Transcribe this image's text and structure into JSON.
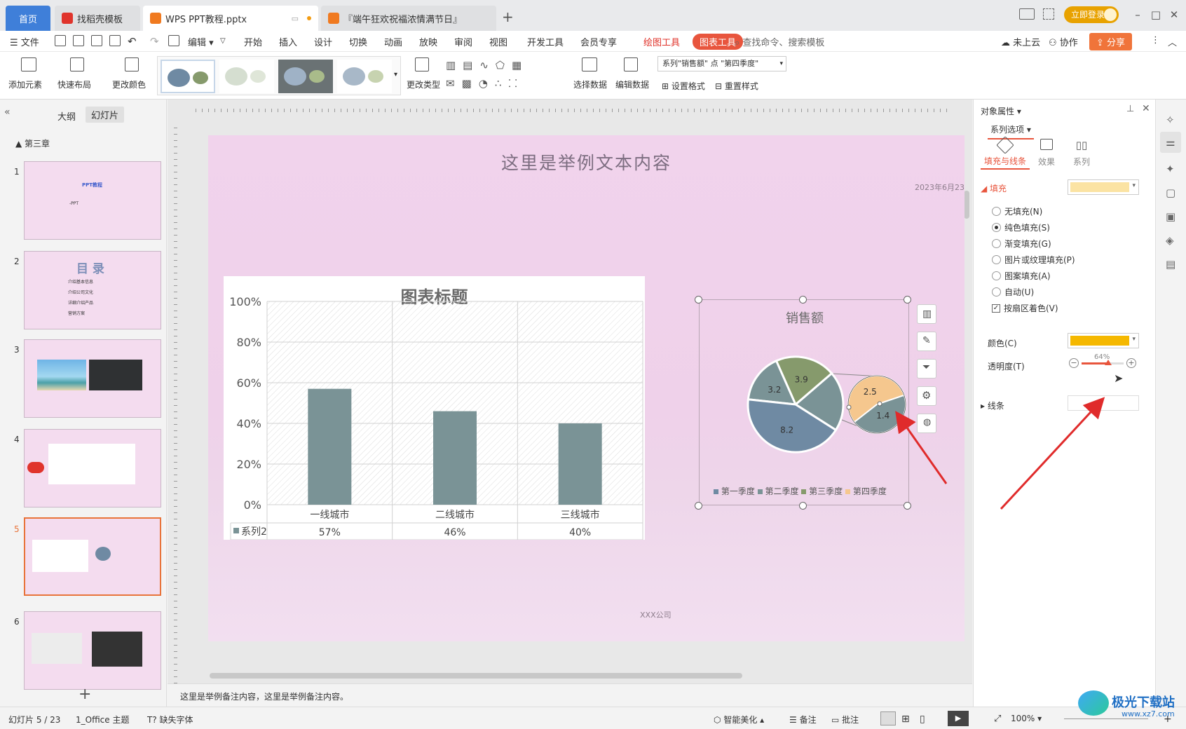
{
  "tabs": {
    "home": "首页",
    "template": "找稻壳模板",
    "doc": "WPS PPT教程.pptx",
    "doc2": "『端午狂欢祝福浓情满节日』",
    "login": "立即登录"
  },
  "menu": {
    "file": "文件",
    "edit": "编辑",
    "items": [
      "开始",
      "插入",
      "设计",
      "切换",
      "动画",
      "放映",
      "审阅",
      "视图",
      "开发工具",
      "会员专享"
    ],
    "draw_tools": "绘图工具",
    "chart_tools": "图表工具",
    "search": "查找命令、搜索模板",
    "cloud": "未上云",
    "collab": "协作",
    "share": "分享"
  },
  "ribbon": {
    "add_element": "添加元素",
    "quick_layout": "快速布局",
    "change_color": "更改颜色",
    "change_type": "更改类型",
    "select_data": "选择数据",
    "edit_data": "编辑数据",
    "selector": "系列\"销售额\" 点 \"第四季度\"",
    "set_format": "设置格式",
    "reset_style": "重置样式"
  },
  "left": {
    "outline": "大纲",
    "slides": "幻灯片",
    "section": "第三章",
    "thumb1_title": "PPT教程",
    "thumb1_sub": "-PPT",
    "thumb2_title": "目 录",
    "thumb2_items": [
      "介绍基本信息",
      "介绍公司文化",
      "详细介绍产品",
      "营销方案"
    ],
    "slide_numbers": [
      "1",
      "2",
      "3",
      "4",
      "5",
      "6"
    ]
  },
  "slide": {
    "title": "这里是举例文本内容",
    "date": "2023年6月23",
    "company": "XXX公司"
  },
  "bar_chart": {
    "title": "图表标题",
    "legend_series": "系列2",
    "chart_data": {
      "type": "bar",
      "categories": [
        "一线城市",
        "二线城市",
        "三线城市"
      ],
      "series": [
        {
          "name": "系列2",
          "values": [
            0.57,
            0.46,
            0.4
          ]
        }
      ],
      "value_labels": [
        "57%",
        "46%",
        "40%"
      ],
      "yticks": [
        "100%",
        "80%",
        "60%",
        "40%",
        "20%",
        "0%"
      ],
      "ylim": [
        0,
        1
      ],
      "bar_color": "#7a9396"
    }
  },
  "pie_chart": {
    "title": "销售额",
    "chart_data": {
      "type": "pie",
      "categories": [
        "第一季度",
        "第二季度",
        "第三季度",
        "第四季度"
      ],
      "main_values": [
        "8.2",
        "3.2",
        "3.9"
      ],
      "sub_values": [
        "2.5",
        "1.4"
      ],
      "colors": [
        "#6f8aa3",
        "#7a9396",
        "#869a6c",
        "#f5c78e"
      ]
    }
  },
  "notes": "这里是举例备注内容，这里是举例备注内容。",
  "panel": {
    "header": "对象属性",
    "series_options": "系列选项",
    "tab_fill": "填充与线条",
    "tab_effect": "效果",
    "tab_series": "系列",
    "fill": "填充",
    "fill_color": "#fbe3a3",
    "radios": [
      "无填充(N)",
      "纯色填充(S)",
      "渐变填充(G)",
      "图片或纹理填充(P)",
      "图案填充(A)",
      "自动(U)"
    ],
    "vary": "按扇区着色(V)",
    "color_label": "颜色(C)",
    "color_value": "#f5b800",
    "transparency_label": "透明度(T)",
    "transparency_value": "64%",
    "transparency_fraction": 0.64,
    "line": "线条"
  },
  "status": {
    "slide_count": "幻灯片 5 / 23",
    "theme": "1_Office 主题",
    "missing_font": "缺失字体",
    "beautify": "智能美化",
    "notes": "备注",
    "comments": "批注",
    "zoom": "100%"
  },
  "watermark": "极光下载站",
  "watermark_url": "www.xz7.com"
}
